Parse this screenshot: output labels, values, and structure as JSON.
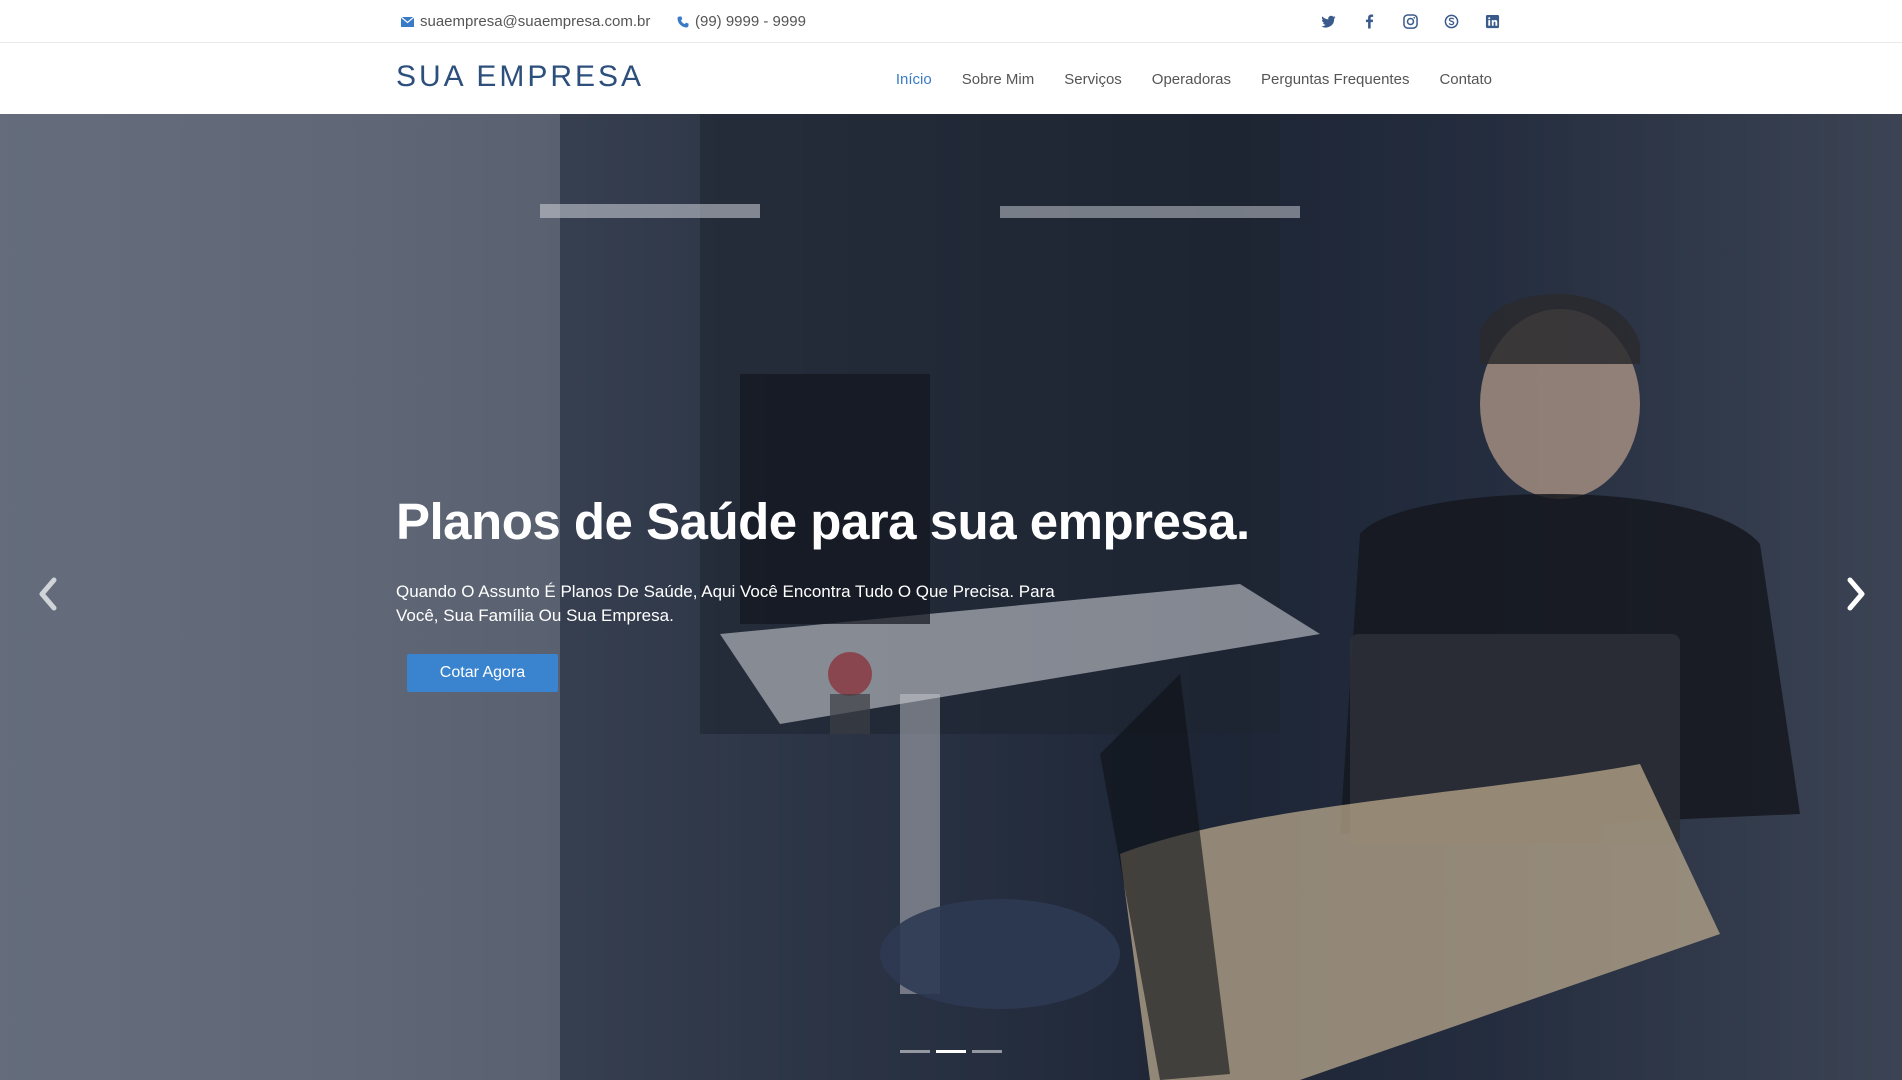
{
  "topbar": {
    "email": "suaempresa@suaempresa.com.br",
    "phone": "(99) 9999 - 9999",
    "socials": [
      "twitter-icon",
      "facebook-icon",
      "instagram-icon",
      "skype-icon",
      "linkedin-icon"
    ]
  },
  "header": {
    "logo": "SUA EMPRESA",
    "nav": [
      {
        "label": "Início",
        "active": true
      },
      {
        "label": "Sobre Mim",
        "active": false
      },
      {
        "label": "Serviços",
        "active": false
      },
      {
        "label": "Operadoras",
        "active": false
      },
      {
        "label": "Perguntas Frequentes",
        "active": false
      },
      {
        "label": "Contato",
        "active": false
      }
    ]
  },
  "hero": {
    "title": "Planos de Saúde para sua empresa.",
    "subtitle": "Quando O Assunto É Planos De Saúde, Aqui Você Encontra Tudo O Que Precisa. Para Você, Sua Família Ou Sua Empresa.",
    "cta_label": "Cotar Agora",
    "slides_count": 3,
    "active_slide": 2
  },
  "colors": {
    "accent": "#3a84cf",
    "logo": "#2d4f7c",
    "nav_active": "#3a7bc8"
  }
}
